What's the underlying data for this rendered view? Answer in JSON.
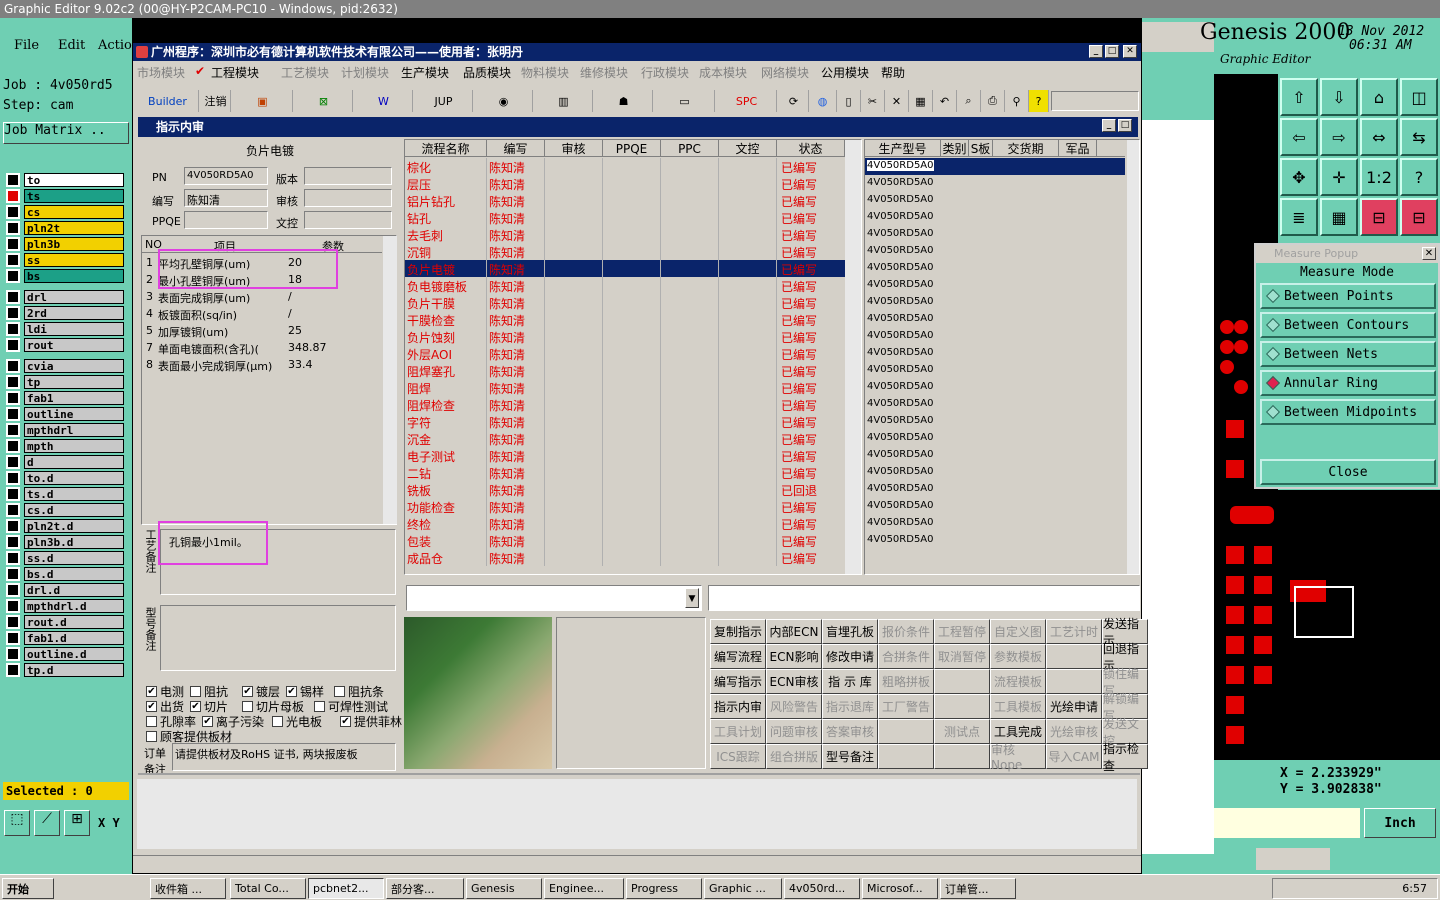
{
  "genesis": {
    "title": "Graphic Editor 9.02c2 (00@HY-P2CAM-PC10 - Windows, pid:2632)",
    "menu": [
      "File",
      "Edit",
      "Actio"
    ],
    "job": "Job : 4v050rd5",
    "step": "Step: cam",
    "job_matrix": "Job Matrix ..",
    "layers": [
      "to",
      "ts",
      "cs",
      "pln2t",
      "pln3b",
      "ss",
      "bs",
      "drl",
      "2rd",
      "ldi",
      "rout",
      "cvia",
      "tp",
      "fab1",
      "outline",
      "mpthdrl",
      "mpth",
      "d",
      "to.d",
      "ts.d",
      "cs.d",
      "pln2t.d",
      "pln3b.d",
      "ss.d",
      "bs.d",
      "drl.d",
      "mpthdrl.d",
      "rout.d",
      "fab1.d",
      "outline.d",
      "tp.d"
    ],
    "selected": "Selected : 0",
    "xy": "X Y",
    "brand": "Genesis 2000",
    "brand_sub": "Graphic Editor",
    "date": "13 Nov 2012",
    "time": "06:31 AM",
    "coord_x": "X = 2.233929\"",
    "coord_y": "Y = 3.902838\"",
    "units": "Inch",
    "measure": {
      "title": "Measure Popup",
      "mode": "Measure Mode",
      "items": [
        "Between Points",
        "Between Contours",
        "Between Nets",
        "Annular Ring",
        "Between Midpoints"
      ],
      "close": "Close"
    }
  },
  "app": {
    "title": "广州程序：深圳市必有德计算机软件技术有限公司——使用者：张明丹",
    "menu": [
      "市场模块",
      "工程模块",
      "工艺模块",
      "计划模块",
      "生产模块",
      "品质模块",
      "物料模块",
      "维修模块",
      "行政模块",
      "成本模块",
      "网络模块",
      "公用模块",
      "帮助"
    ],
    "toolbar": [
      "Builder",
      "注销",
      "JUP",
      "SPC"
    ],
    "inner_title": "指示内审",
    "section": "负片电镀",
    "labels": {
      "pn": "PN",
      "version": "版本",
      "writer": "编写",
      "review": "审核",
      "ppqe": "PPQE",
      "doc": "文控"
    },
    "values": {
      "pn": "4V050RD5A0",
      "writer": "陈知清"
    },
    "param_headers": [
      "NO",
      "项目",
      "参数"
    ],
    "params": [
      {
        "no": "1",
        "item": "平均孔壁铜厚(um)",
        "val": "20"
      },
      {
        "no": "2",
        "item": "最小孔壁铜厚(um)",
        "val": "18"
      },
      {
        "no": "3",
        "item": "表面完成铜厚(um)",
        "val": "/"
      },
      {
        "no": "4",
        "item": "板镀面积(sq/in)",
        "val": "/"
      },
      {
        "no": "5",
        "item": "加厚镀铜(um)",
        "val": "25"
      },
      {
        "no": "7",
        "item": "单面电镀面积(含孔)(",
        "val": "348.87"
      },
      {
        "no": "8",
        "item": "表面最小完成铜厚(μm)",
        "val": "33.4"
      }
    ],
    "proc_note_label": "工艺备注",
    "proc_note": "孔铜最小1mil。",
    "model_note_label": "型号备注",
    "checks": [
      {
        "label": "电测",
        "on": true
      },
      {
        "label": "阻抗",
        "on": false
      },
      {
        "label": "镀层",
        "on": true
      },
      {
        "label": "锡样",
        "on": true
      },
      {
        "label": "阻抗条",
        "on": false
      },
      {
        "label": "出货",
        "on": true
      },
      {
        "label": "切片",
        "on": true
      },
      {
        "label": "切片母板",
        "on": false
      },
      {
        "label": "可焊性测试",
        "on": false
      },
      {
        "label": "孔隙率",
        "on": false
      },
      {
        "label": "离子污染",
        "on": true
      },
      {
        "label": "光电板",
        "on": false
      },
      {
        "label": "提供菲林",
        "on": true
      },
      {
        "label": "顾客提供板材",
        "on": false
      }
    ],
    "order_label": "订单备注",
    "order_note": "请提供板材及RoHS 证书, 两块报废板",
    "flow_headers": [
      "流程名称",
      "编写",
      "审核",
      "PPQE",
      "PPC",
      "文控",
      "状态"
    ],
    "flow": [
      [
        "棕化",
        "陈知清",
        "已编写"
      ],
      [
        "层压",
        "陈知清",
        "已编写"
      ],
      [
        "铝片钻孔",
        "陈知清",
        "已编写"
      ],
      [
        "钻孔",
        "陈知清",
        "已编写"
      ],
      [
        "去毛刺",
        "陈知清",
        "已编写"
      ],
      [
        "沉铜",
        "陈知清",
        "已编写"
      ],
      [
        "负片电镀",
        "陈知清",
        "已编写"
      ],
      [
        "负电镀磨板",
        "陈知清",
        "已编写"
      ],
      [
        "负片干膜",
        "陈知清",
        "已编写"
      ],
      [
        "干膜检查",
        "陈知清",
        "已编写"
      ],
      [
        "负片蚀刻",
        "陈知清",
        "已编写"
      ],
      [
        "外层AOI",
        "陈知清",
        "已编写"
      ],
      [
        "阻焊塞孔",
        "陈知清",
        "已编写"
      ],
      [
        "阻焊",
        "陈知清",
        "已编写"
      ],
      [
        "阻焊检查",
        "陈知清",
        "已编写"
      ],
      [
        "字符",
        "陈知清",
        "已编写"
      ],
      [
        "沉金",
        "陈知清",
        "已编写"
      ],
      [
        "电子测试",
        "陈知清",
        "已编写"
      ],
      [
        "二钻",
        "陈知清",
        "已编写"
      ],
      [
        "铣板",
        "陈知清",
        "已回退"
      ],
      [
        "功能检查",
        "陈知清",
        "已编写"
      ],
      [
        "终检",
        "陈知清",
        "已编写"
      ],
      [
        "包装",
        "陈知清",
        "已编写"
      ],
      [
        "成品仓",
        "陈知清",
        "已编写"
      ]
    ],
    "prod_headers": [
      "生产型号",
      "类别",
      "S板",
      "交货期",
      "军品"
    ],
    "prod_model": "4V050RD5A0",
    "buttons": [
      [
        "复制指示",
        "内部ECN",
        "盲埋孔板",
        "报价条件",
        "工程暂停",
        "自定义图",
        "工艺计时",
        "发送指示"
      ],
      [
        "编写流程",
        "ECN影响",
        "修改申请",
        "合拼条件",
        "取消暂停",
        "参数模板",
        "",
        "回退指示"
      ],
      [
        "编写指示",
        "ECN审核",
        "指 示 库",
        "粗略拼板",
        "",
        "流程模板",
        "",
        "锁住编写"
      ],
      [
        "指示内审",
        "风险警告",
        "指示退库",
        "工厂警告",
        "",
        "工具模板",
        "光绘申请",
        "解锁编写"
      ],
      [
        "工具计划",
        "问题审核",
        "答案审核",
        "",
        "测试点",
        "工具完成",
        "光绘审核",
        "发送文控"
      ],
      [
        "ICS跟踪",
        "组合拼版",
        "型号备注",
        "",
        "",
        "审核Nope",
        "导入CAM",
        "指示检查"
      ]
    ],
    "enabled": [
      [
        1,
        1,
        1,
        0,
        0,
        0,
        0,
        1
      ],
      [
        1,
        1,
        1,
        0,
        0,
        0,
        0,
        1
      ],
      [
        1,
        1,
        1,
        0,
        0,
        0,
        0,
        0
      ],
      [
        1,
        0,
        0,
        0,
        0,
        0,
        1,
        0
      ],
      [
        0,
        0,
        0,
        0,
        0,
        1,
        0,
        0
      ],
      [
        0,
        0,
        1,
        0,
        0,
        0,
        0,
        1
      ]
    ]
  },
  "taskbar": {
    "start": "开始",
    "tasks": [
      "收件箱 ...",
      "Total Co...",
      "pcbnet2...",
      "部分客...",
      "Genesis",
      "Enginee...",
      "Progress",
      "Graphic ...",
      "4v050rd...",
      "Microsof...",
      "订单管..."
    ],
    "clock": "6:57"
  }
}
